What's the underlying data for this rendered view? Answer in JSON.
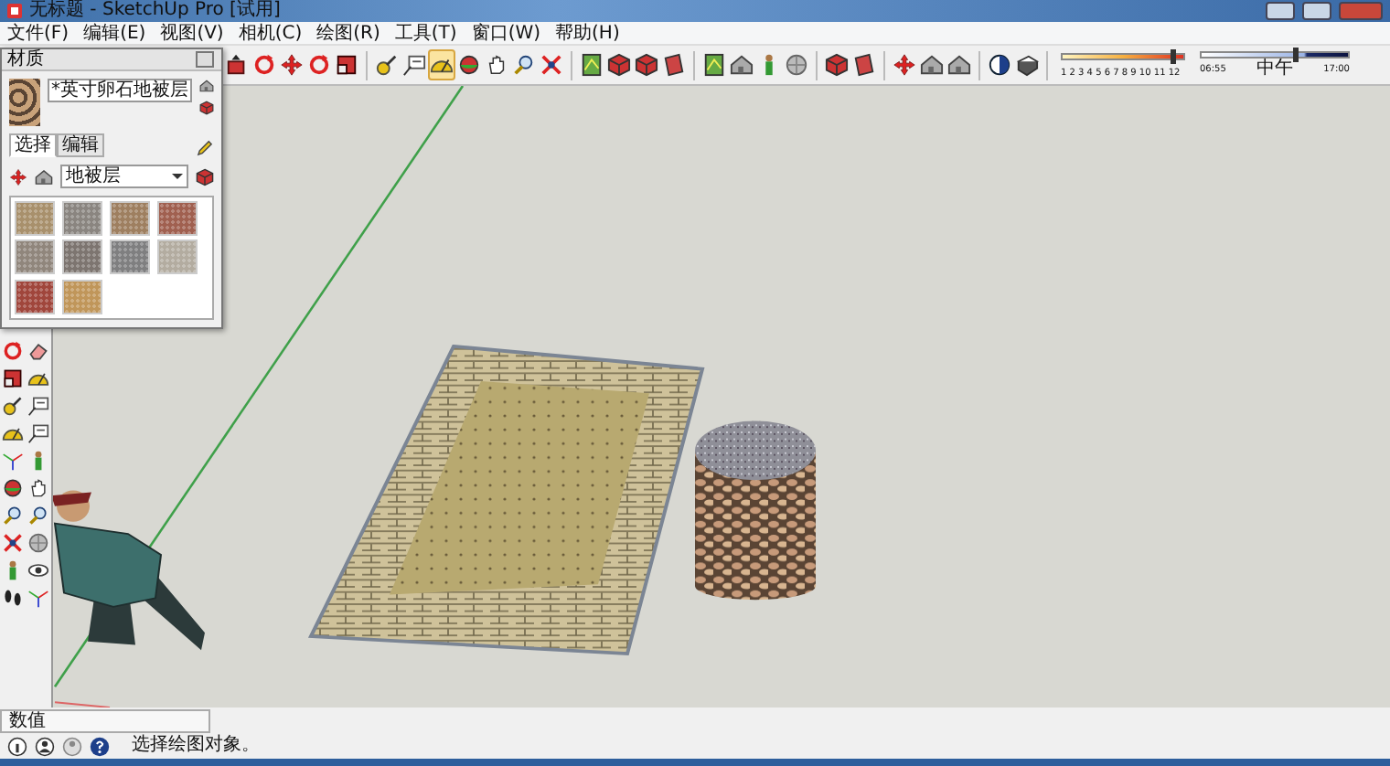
{
  "window": {
    "title": "无标题 - SketchUp Pro [试用]"
  },
  "menu_bar": [
    {
      "label": "文件(F)"
    },
    {
      "label": "编辑(E)"
    },
    {
      "label": "视图(V)"
    },
    {
      "label": "相机(C)"
    },
    {
      "label": "绘图(R)"
    },
    {
      "label": "工具(T)"
    },
    {
      "label": "窗口(W)"
    },
    {
      "label": "帮助(H)"
    }
  ],
  "toolbar": {
    "buttons": [
      {
        "selected": false
      },
      {
        "selected": false
      },
      {
        "selected": false
      },
      {
        "selected": false
      },
      {
        "selected": false
      },
      {
        "selected": false
      },
      {
        "selected": false
      },
      {
        "selected": true
      },
      {
        "selected": false
      },
      {
        "selected": false
      },
      {
        "selected": false
      },
      {
        "selected": false
      },
      {
        "selected": false
      },
      {
        "selected": false
      },
      {
        "selected": false
      },
      {
        "selected": false
      },
      {
        "selected": false
      },
      {
        "selected": false
      },
      {
        "selected": false
      },
      {
        "selected": false
      },
      {
        "selected": false
      },
      {
        "selected": false
      },
      {
        "selected": false
      },
      {
        "selected": false
      },
      {
        "selected": false
      },
      {
        "selected": false
      },
      {
        "selected": false
      }
    ]
  },
  "date_slider": {
    "scale": "1 2 3 4 5 6 7 8 9 10 11 12",
    "level": 0.9
  },
  "time_slider": {
    "start": "06:55",
    "middle": "中午",
    "end": "17:00",
    "level": 0.62
  },
  "materials_panel": {
    "title": "材质",
    "material_name": "*英寸卵石地被层",
    "tabs": [
      {
        "label": "选择",
        "selected": true
      },
      {
        "label": "编辑",
        "selected": false
      }
    ],
    "library": "地被层",
    "swatches": [
      {
        "color": "#a8906c"
      },
      {
        "color": "#8a8580"
      },
      {
        "color": "#9e7f60"
      },
      {
        "color": "#a06050"
      },
      {
        "color": "#90867c"
      },
      {
        "color": "#7d7570"
      },
      {
        "color": "#7f7f80"
      },
      {
        "color": "#b3aca0"
      },
      {
        "color": "#a0463c"
      },
      {
        "color": "#c0965a"
      }
    ]
  },
  "status_bar": {
    "measurement_label": "数值",
    "hint": "选择绘图对象。"
  }
}
